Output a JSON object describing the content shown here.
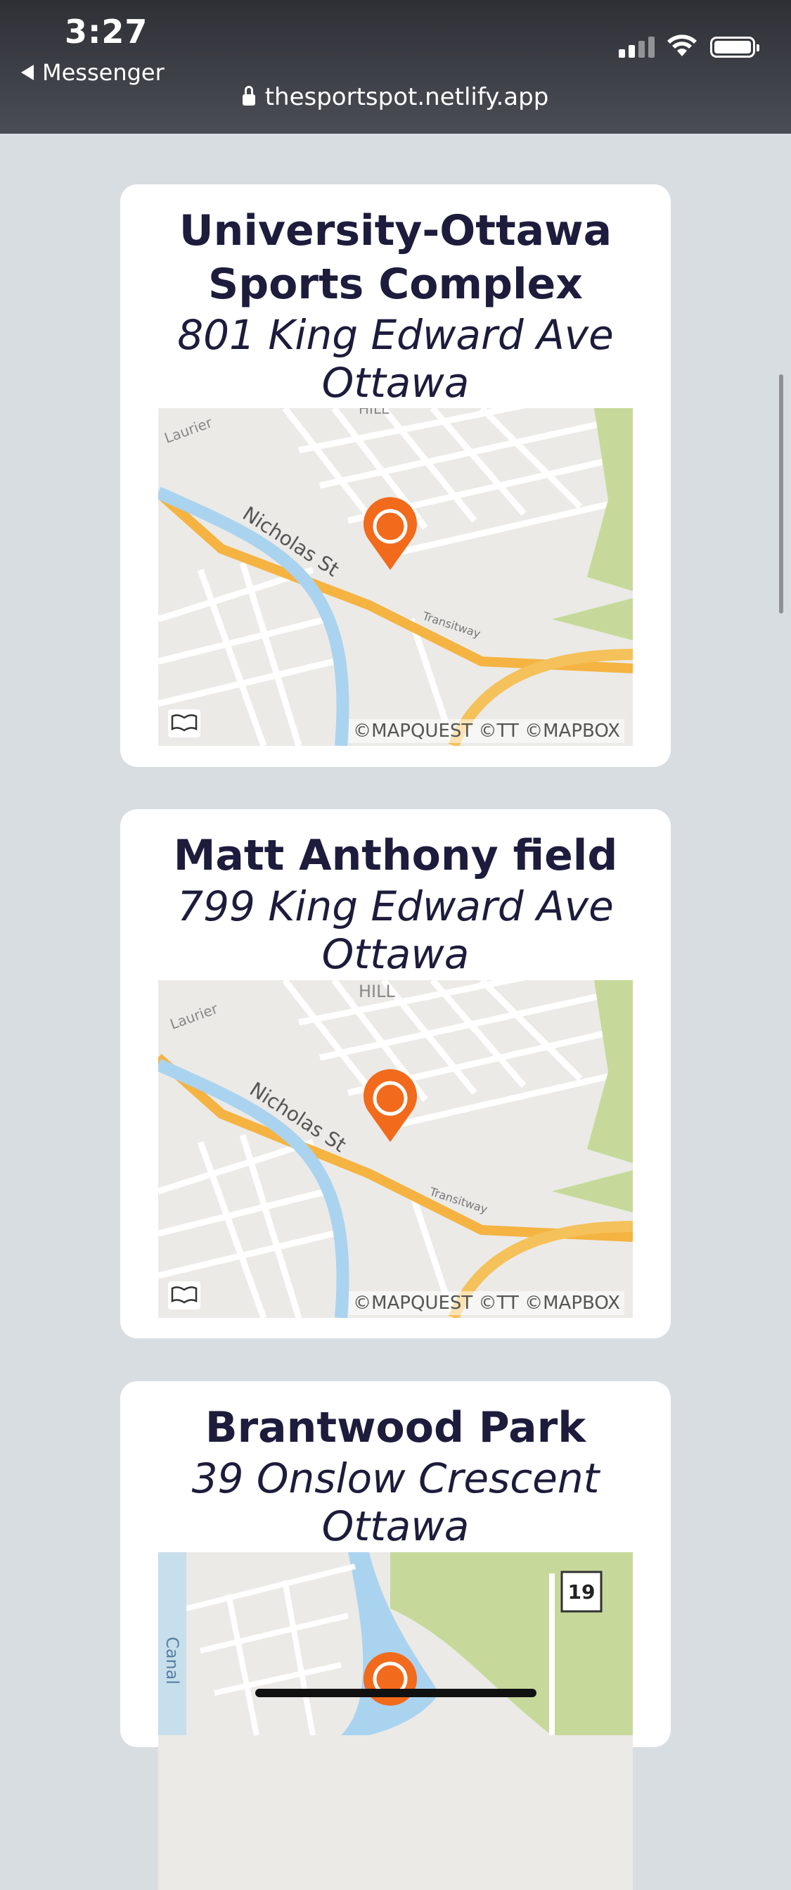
{
  "status_bar": {
    "time": "3:27",
    "back_app": "Messenger",
    "url": "thesportspot.netlify.app"
  },
  "venues": [
    {
      "name": "University-Ottawa Sports Complex",
      "name_line1": "University-Ottawa",
      "name_line2": "Sports Complex",
      "address_line1": "801 King Edward Ave",
      "address_line2": "Ottawa",
      "map": {
        "street_label": "Nicholas St",
        "district_label": "HILL",
        "road_label": "Laurier",
        "transit_label": "Transitway",
        "attribution": "©MAPQUEST ©TT ©MAPBOX"
      }
    },
    {
      "name": "Matt Anthony field",
      "address_line1": "799 King Edward Ave",
      "address_line2": "Ottawa",
      "map": {
        "street_label": "Nicholas St",
        "district_label": "HILL",
        "road_label": "Laurier",
        "transit_label": "Transitway",
        "attribution": "©MAPQUEST ©TT ©MAPBOX"
      }
    },
    {
      "name": "Brantwood Park",
      "address_line1": "39 Onslow Crescent",
      "address_line2": "Ottawa",
      "map": {
        "route_shield": "19",
        "canal_label": "Canal"
      }
    }
  ],
  "colors": {
    "page_background": "#d8dde2",
    "heading_text": "#1d1c3c",
    "map_marker": "#f26a1b",
    "major_road": "#f5b342",
    "water": "#aad3f0",
    "park": "#c6d99a"
  }
}
